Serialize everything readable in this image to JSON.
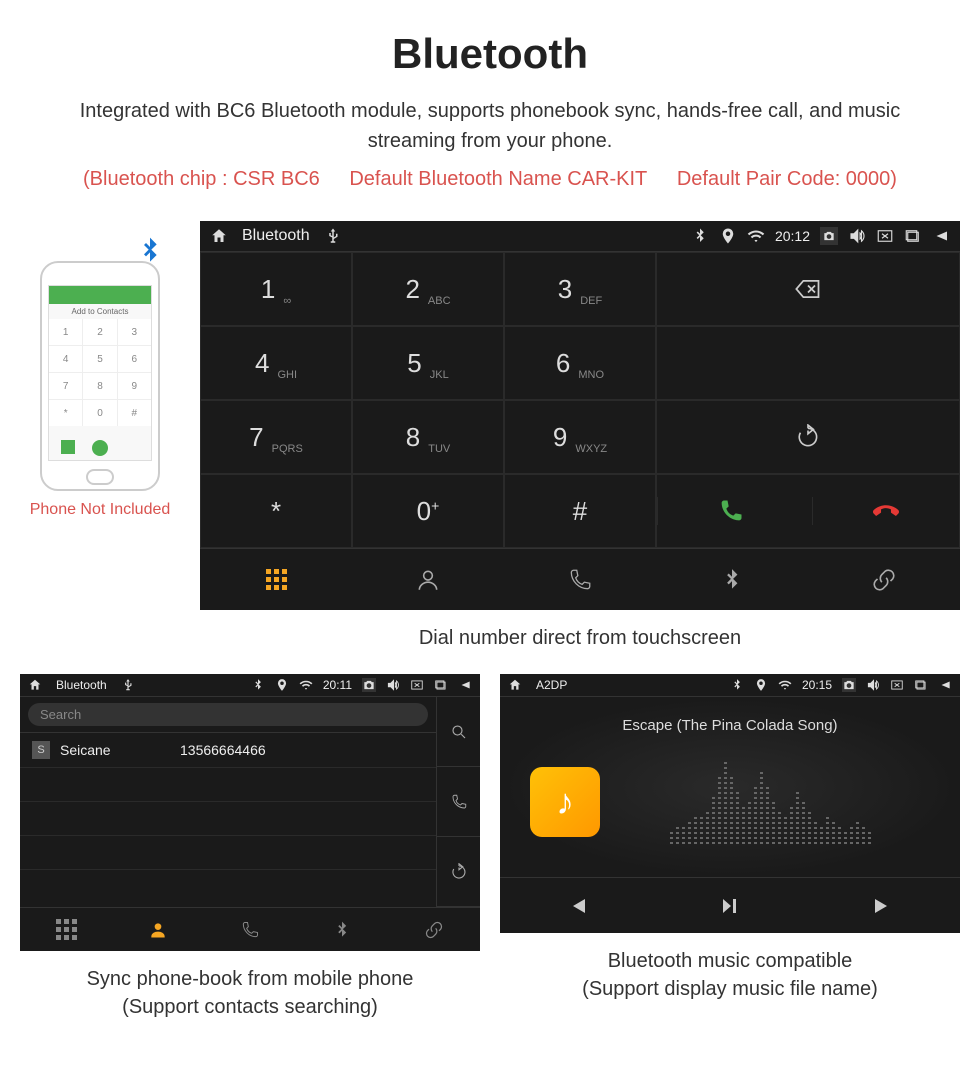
{
  "header": {
    "title": "Bluetooth",
    "subtitle": "Integrated with BC6 Bluetooth module, supports phonebook sync, hands-free call, and music streaming from your phone.",
    "spec1": "(Bluetooth chip : CSR BC6",
    "spec2": "Default Bluetooth Name CAR-KIT",
    "spec3": "Default Pair Code: 0000)"
  },
  "phone": {
    "caption": "Phone Not Included"
  },
  "dialer": {
    "statusbar": {
      "title": "Bluetooth",
      "time": "20:12"
    },
    "keys": [
      {
        "d": "1",
        "s": "∞"
      },
      {
        "d": "2",
        "s": "ABC"
      },
      {
        "d": "3",
        "s": "DEF"
      },
      {
        "d": "4",
        "s": "GHI"
      },
      {
        "d": "5",
        "s": "JKL"
      },
      {
        "d": "6",
        "s": "MNO"
      },
      {
        "d": "7",
        "s": "PQRS"
      },
      {
        "d": "8",
        "s": "TUV"
      },
      {
        "d": "9",
        "s": "WXYZ"
      },
      {
        "d": "*",
        "s": ""
      },
      {
        "d": "0",
        "s": "+"
      },
      {
        "d": "#",
        "s": ""
      }
    ],
    "caption": "Dial number direct from touchscreen"
  },
  "phonebook": {
    "statusbar": {
      "title": "Bluetooth",
      "time": "20:11"
    },
    "search": "Search",
    "contact": {
      "badge": "S",
      "name": "Seicane",
      "number": "13566664466"
    },
    "caption1": "Sync phone-book from mobile phone",
    "caption2": "(Support contacts searching)"
  },
  "music": {
    "statusbar": {
      "title": "A2DP",
      "time": "20:15"
    },
    "track": "Escape (The Pina Colada Song)",
    "caption1": "Bluetooth music compatible",
    "caption2": "(Support display music file name)"
  }
}
